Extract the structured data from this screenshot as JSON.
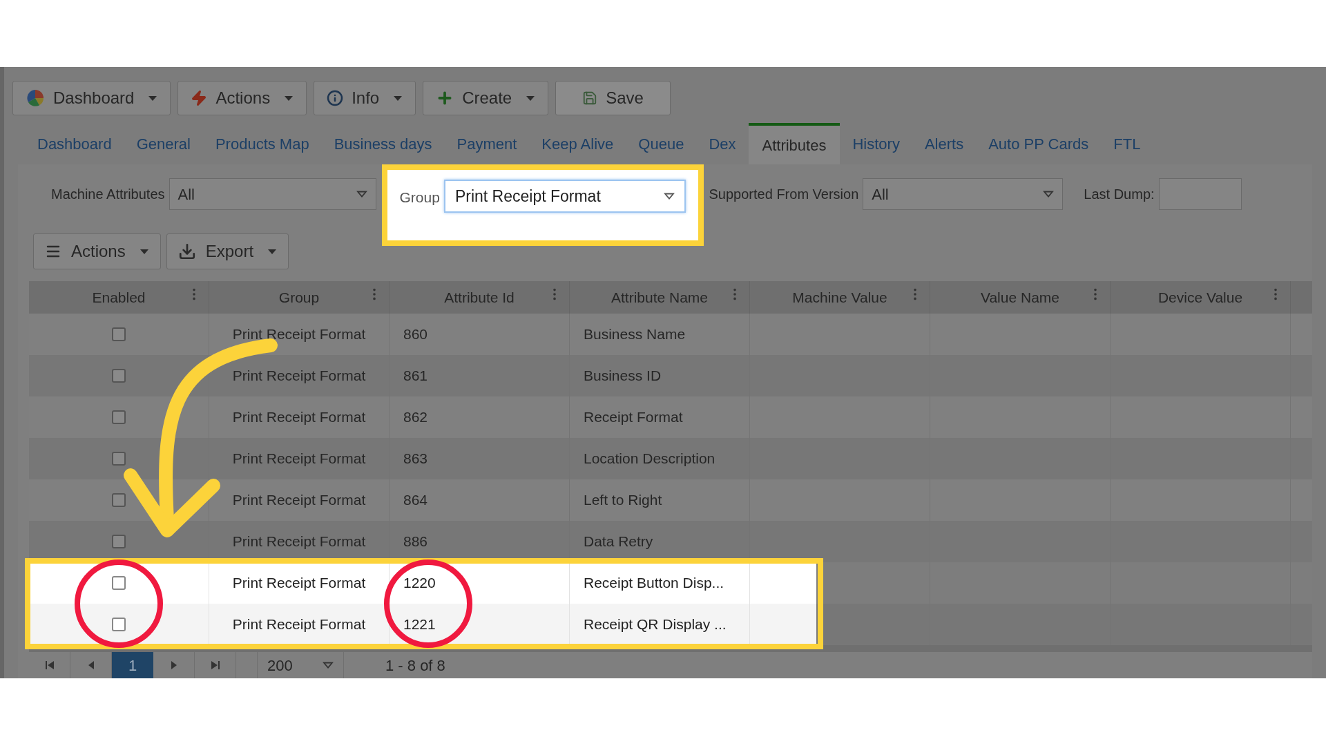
{
  "toolbar": [
    {
      "label": "Dashboard",
      "menu": true
    },
    {
      "label": "Actions",
      "menu": true
    },
    {
      "label": "Info",
      "menu": true
    },
    {
      "label": "Create",
      "menu": true
    },
    {
      "label": "Save",
      "menu": false
    }
  ],
  "tabs": [
    {
      "label": "Dashboard",
      "selected": false
    },
    {
      "label": "General",
      "selected": false
    },
    {
      "label": "Products Map",
      "selected": false
    },
    {
      "label": "Business days",
      "selected": false
    },
    {
      "label": "Payment",
      "selected": false
    },
    {
      "label": "Keep Alive",
      "selected": false
    },
    {
      "label": "Queue",
      "selected": false
    },
    {
      "label": "Dex",
      "selected": false
    },
    {
      "label": "Attributes",
      "selected": true
    },
    {
      "label": "History",
      "selected": false
    },
    {
      "label": "Alerts",
      "selected": false
    },
    {
      "label": "Auto PP Cards",
      "selected": false
    },
    {
      "label": "FTL",
      "selected": false
    }
  ],
  "filters": {
    "machine_attributes": {
      "label": "Machine Attributes",
      "value": "All"
    },
    "group": {
      "label": "Group",
      "value": "Print Receipt Format",
      "highlighted": true
    },
    "supported_from_version": {
      "label": "Supported From Version",
      "value": "All"
    },
    "last_dump": {
      "label": "Last Dump:"
    }
  },
  "grid_actions": [
    {
      "label": "Actions"
    },
    {
      "label": "Export"
    }
  ],
  "table": {
    "columns": [
      "Enabled",
      "Group",
      "Attribute Id",
      "Attribute Name",
      "Machine Value",
      "Value Name",
      "Device Value"
    ],
    "rows": [
      {
        "checked": false,
        "group": "Print Receipt Format",
        "id": "860",
        "name": "Business Name",
        "highlighted": false
      },
      {
        "checked": false,
        "group": "Print Receipt Format",
        "id": "861",
        "name": "Business ID",
        "highlighted": false
      },
      {
        "checked": false,
        "group": "Print Receipt Format",
        "id": "862",
        "name": "Receipt Format",
        "highlighted": false
      },
      {
        "checked": false,
        "group": "Print Receipt Format",
        "id": "863",
        "name": "Location Description",
        "highlighted": false
      },
      {
        "checked": false,
        "group": "Print Receipt Format",
        "id": "864",
        "name": "Left to Right",
        "highlighted": false
      },
      {
        "checked": false,
        "group": "Print Receipt Format",
        "id": "886",
        "name": "Data Retry",
        "highlighted": false
      },
      {
        "checked": false,
        "group": "Print Receipt Format",
        "id": "1220",
        "name": "Receipt Button Disp...",
        "highlighted": true
      },
      {
        "checked": false,
        "group": "Print Receipt Format",
        "id": "1221",
        "name": "Receipt QR Display ...",
        "highlighted": true
      }
    ]
  },
  "pager": {
    "page": "1",
    "page_size": "200",
    "range": "1 - 8 of 8"
  }
}
